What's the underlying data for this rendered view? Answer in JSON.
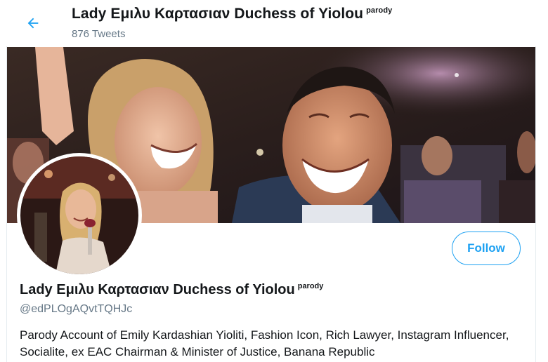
{
  "header": {
    "title": "Lady Εμιλυ Καρτασιαν Duchess of Yiolou",
    "title_badge": "parody",
    "tweet_count": "876 Tweets"
  },
  "profile": {
    "name": "Lady Εμιλυ Καρτασιαν Duchess of Yiolou",
    "name_badge": "parody",
    "handle": "@edPLOgAQvtTQHJc",
    "bio": "Parody Account of Emily Kardashian Yioliti, Fashion Icon, Rich Lawyer, Instagram Influencer, Socialite,  ex EAC Chairman & Minister of Justice, Banana Republic"
  },
  "actions": {
    "follow_label": "Follow"
  },
  "icons": {
    "back": "arrow-left-icon"
  },
  "colors": {
    "accent": "#1da1f2",
    "secondary_text": "#657786",
    "primary_text": "#14171a"
  }
}
